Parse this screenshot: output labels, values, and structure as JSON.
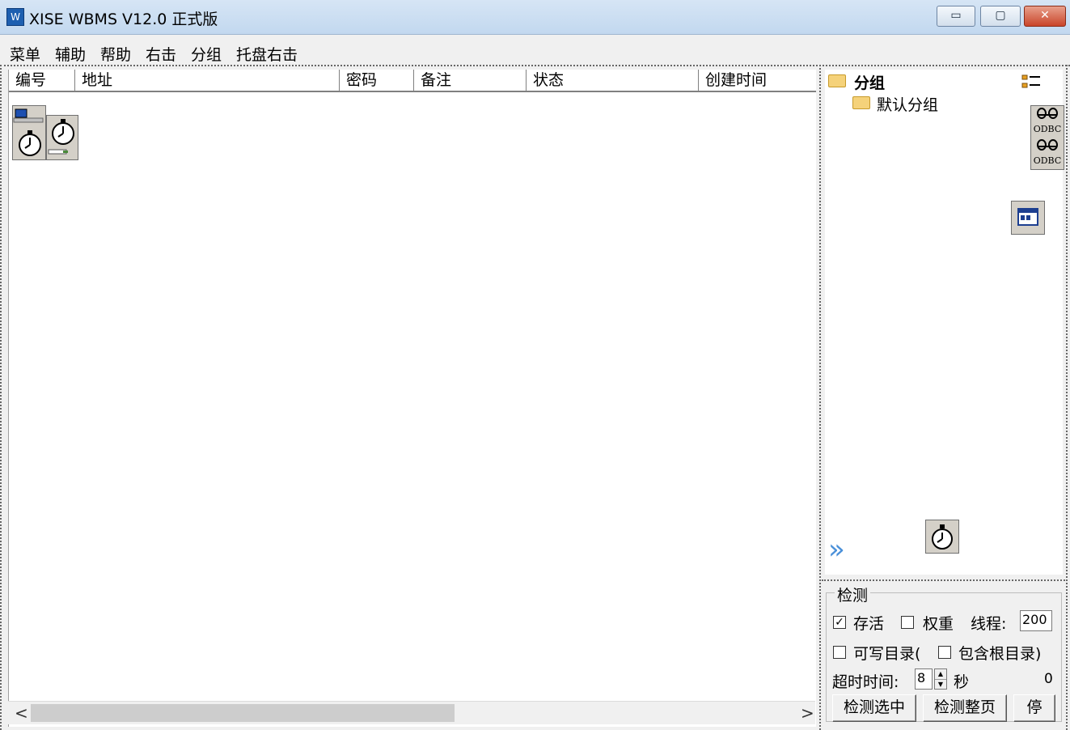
{
  "window": {
    "title": "XISE WBMS V12.0 正式版",
    "minimize_glyph": "▭",
    "maximize_glyph": "▢",
    "close_glyph": "✕"
  },
  "menu": [
    "菜单",
    "辅助",
    "帮助",
    "右击",
    "分组",
    "托盘右击"
  ],
  "table": {
    "columns": [
      "编号",
      "地址",
      "密码",
      "备注",
      "状态",
      "创建时间"
    ]
  },
  "scrollbar": {
    "left_arrow": "<",
    "right_arrow": ">"
  },
  "tree": {
    "root": "分组",
    "children": [
      "默认分组"
    ]
  },
  "icons": {
    "odbc_label": "ODBC",
    "more_arrows": "»"
  },
  "detect": {
    "title": "检测",
    "keepalive_label": "存活",
    "keepalive_checked": "✓",
    "weight_label": "权重",
    "threads_label": "线程:",
    "threads_value": "200",
    "writable_label": "可写目录(",
    "include_root_label": "包含根目录)",
    "timeout_label": "超时时间:",
    "timeout_value": "8",
    "seconds_label": "秒",
    "count": "0",
    "check_selected": "检测选中",
    "check_page": "检测整页",
    "stop": "停"
  },
  "colors": {
    "title_bar": "#c2d8ef",
    "close_button": "#c9452a",
    "folder": "#f5d27a"
  }
}
